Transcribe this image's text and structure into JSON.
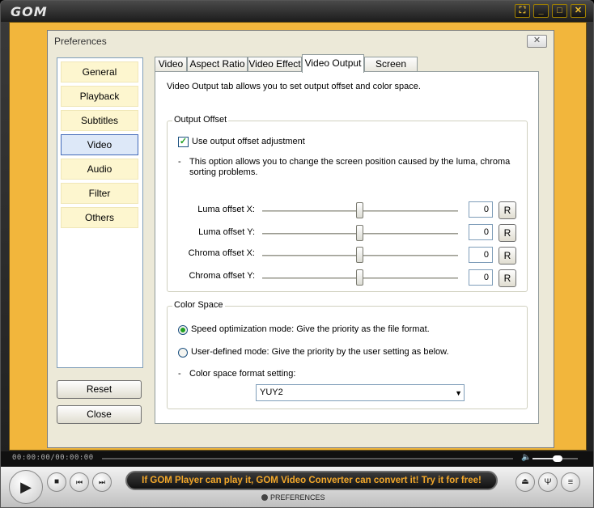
{
  "app": {
    "logo_text": "GOM",
    "window_buttons": [
      "restore",
      "minimize",
      "maximize",
      "close"
    ]
  },
  "dialog": {
    "title": "Preferences",
    "close_label": "✕",
    "nav": [
      {
        "label": "General",
        "active": false
      },
      {
        "label": "Playback",
        "active": false
      },
      {
        "label": "Subtitles",
        "active": false
      },
      {
        "label": "Video",
        "active": true
      },
      {
        "label": "Audio",
        "active": false
      },
      {
        "label": "Filter",
        "active": false
      },
      {
        "label": "Others",
        "active": false
      }
    ],
    "reset_label": "Reset",
    "close_button_label": "Close",
    "tabs": [
      {
        "label": "Video",
        "active": false
      },
      {
        "label": "Aspect Ratio",
        "active": false
      },
      {
        "label": "Video Effect",
        "active": false
      },
      {
        "label": "Video Output",
        "active": true
      },
      {
        "label": "Screen Size",
        "active": false
      }
    ],
    "intro": "Video Output tab allows you to set output offset and color space.",
    "output_offset": {
      "title": "Output Offset",
      "checkbox_label": "Use output offset adjustment",
      "checkbox_checked": true,
      "dash": "-",
      "note": "This option allows you to change the screen position caused by the luma, chroma sorting problems.",
      "sliders": [
        {
          "label": "Luma offset X:",
          "value": "0",
          "reset": "R"
        },
        {
          "label": "Luma offset Y:",
          "value": "0",
          "reset": "R"
        },
        {
          "label": "Chroma offset X:",
          "value": "0",
          "reset": "R"
        },
        {
          "label": "Chroma offset Y:",
          "value": "0",
          "reset": "R"
        }
      ]
    },
    "color_space": {
      "title": "Color Space",
      "option_speed": "Speed optimization mode: Give the priority as the file format.",
      "option_user": "User-defined mode: Give the priority by the user setting as below.",
      "selected": "speed",
      "dash": "-",
      "format_label": "Color space format setting:",
      "format_value": "YUY2"
    }
  },
  "player": {
    "time": "00:00:00/00:00:00",
    "volume_level": 0.55,
    "ticker": "If GOM Player can play it, GOM Video Converter can convert it! Try it for free!",
    "preferences_label": "PREFERENCES"
  }
}
